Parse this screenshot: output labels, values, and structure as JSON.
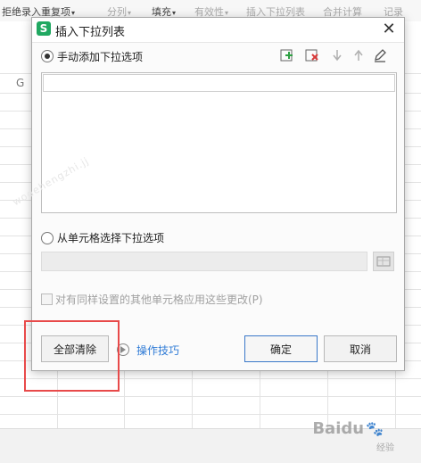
{
  "toolbar": {
    "items": [
      {
        "label": "拒绝录入重复项",
        "dim": false
      },
      {
        "label": "分列",
        "dim": true
      },
      {
        "label": "填充",
        "dim": false
      },
      {
        "label": "有效性",
        "dim": true
      },
      {
        "label": "插入下拉列表",
        "dim": true
      },
      {
        "label": "合并计算",
        "dim": true
      },
      {
        "label": "记录",
        "dim": true
      }
    ]
  },
  "sheet": {
    "column_g": "G"
  },
  "dialog": {
    "title": "插入下拉列表",
    "close_glyph": "✕",
    "app_icon_letter": "S",
    "radio_manual_label": "手动添加下拉选项",
    "radio_source_label": "从单元格选择下拉选项",
    "checkbox_label": "对有同样设置的其他单元格应用这些更改(P)",
    "clear_all_label": "全部清除",
    "tips_label": "操作技巧",
    "ok_label": "确定",
    "cancel_label": "取消"
  },
  "watermark": {
    "baidu": "Baidu",
    "baidu_sub": "经验",
    "left_text": "wodehengzhi.jj"
  },
  "colors": {
    "accent_green": "#20a861",
    "link_blue": "#2f7bd6",
    "primary_border": "#3a78c9",
    "highlight_red": "#e84a4a"
  }
}
